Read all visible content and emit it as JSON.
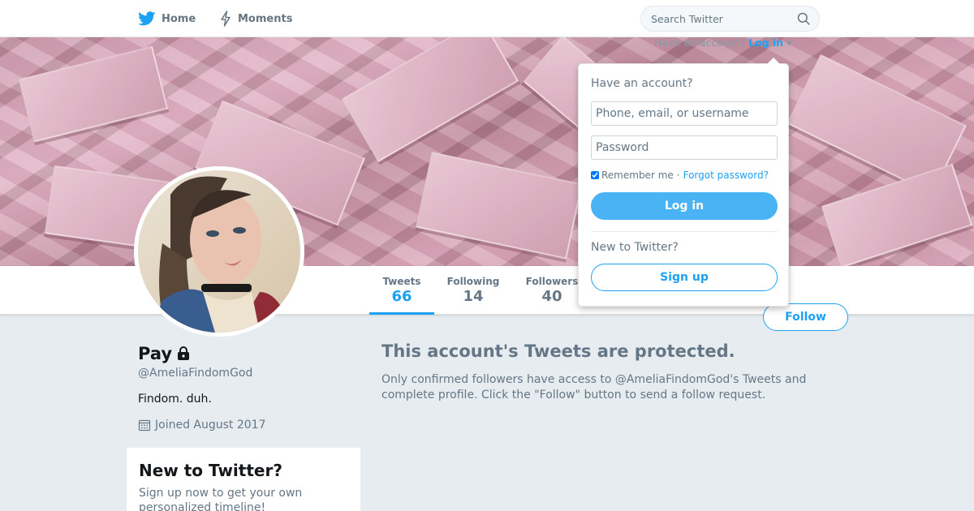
{
  "nav": {
    "home_label": "Home",
    "moments_label": "Moments",
    "home_icon": "twitter-bird-icon",
    "moments_icon": "lightning-icon"
  },
  "search": {
    "placeholder": "Search Twitter",
    "icon": "search-icon"
  },
  "login_toggle": {
    "prefix": "Have an account?",
    "link": "Log in",
    "caret": "▾"
  },
  "profile": {
    "name": "Pay",
    "lock_icon": "lock-icon",
    "handle": "@AmeliaFindomGod",
    "bio": "Findom. duh.",
    "joined": "Joined August 2017",
    "calendar_icon": "calendar-icon"
  },
  "stats": [
    {
      "label": "Tweets",
      "value": "66"
    },
    {
      "label": "Following",
      "value": "14"
    },
    {
      "label": "Followers",
      "value": "40"
    }
  ],
  "follow_button": "Follow",
  "protected": {
    "title": "This account's Tweets are protected.",
    "text": "Only confirmed followers have access to @AmeliaFindomGod's Tweets and complete profile. Click the \"Follow\" button to send a follow request."
  },
  "new_card": {
    "title": "New to Twitter?",
    "text": "Sign up now to get your own personalized timeline!"
  },
  "login_dropdown": {
    "have_account": "Have an account?",
    "username_placeholder": "Phone, email, or username",
    "password_placeholder": "Password",
    "remember_me": "Remember me",
    "separator": "·",
    "forgot_password": "Forgot password?",
    "login_button": "Log in",
    "new_to_twitter": "New to Twitter?",
    "signup_button": "Sign up"
  },
  "colors": {
    "accent": "#1da1f2",
    "login_button": "#4ab3f4",
    "background": "#e6ecf0",
    "muted_text": "#657786"
  }
}
